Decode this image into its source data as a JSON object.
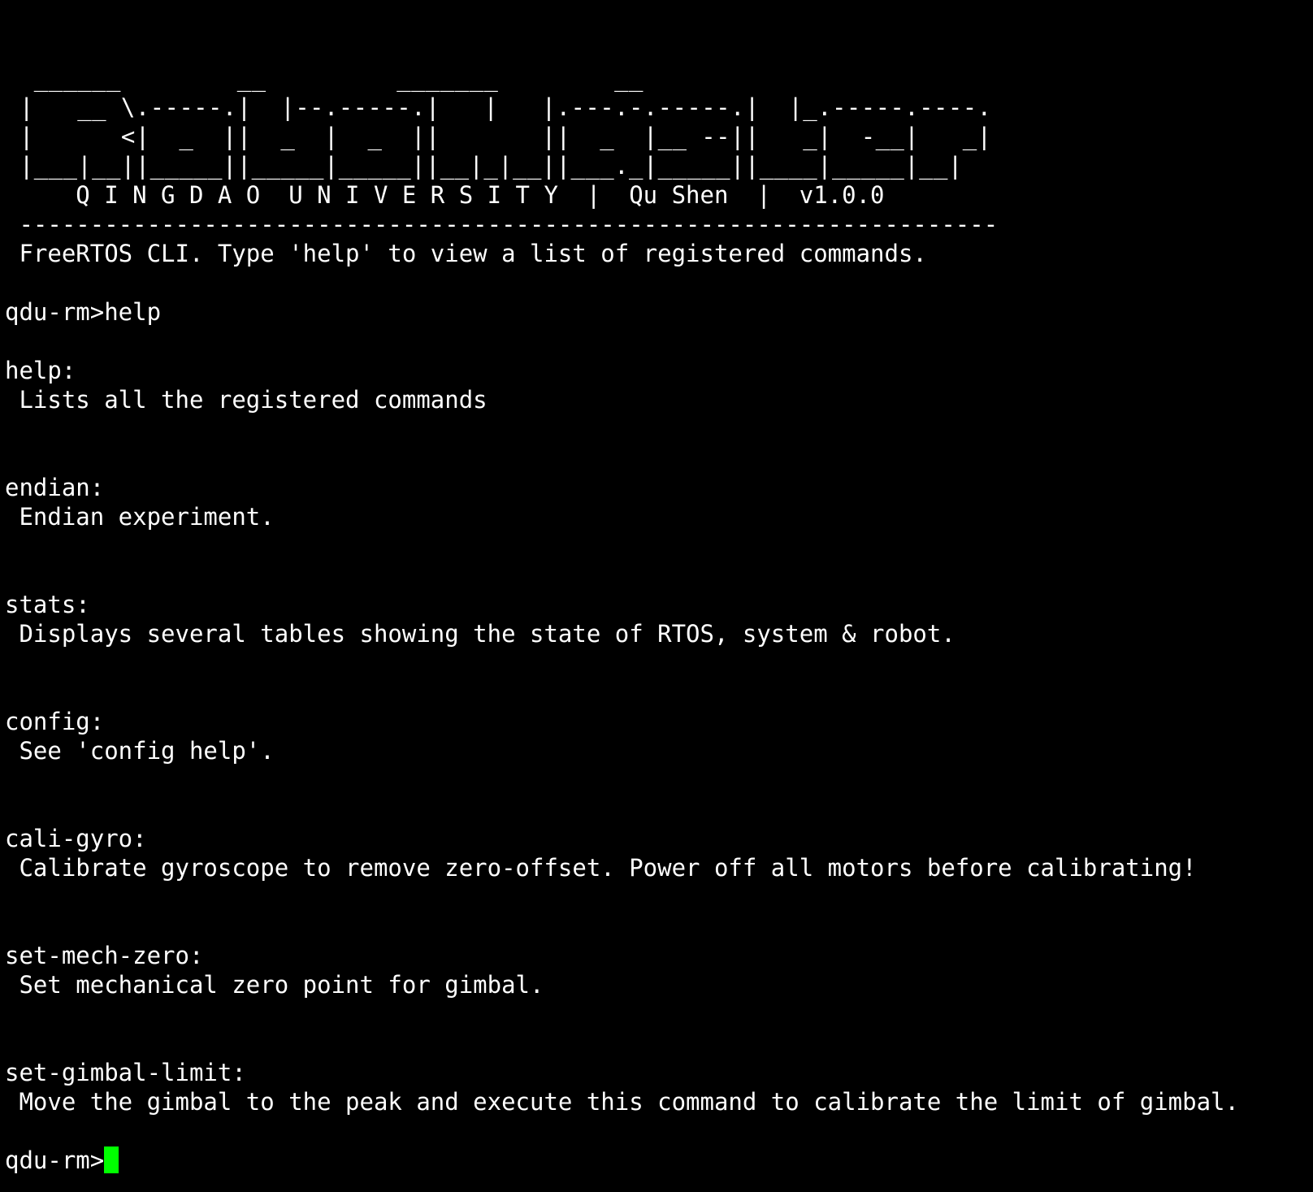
{
  "colors": {
    "background": "#000000",
    "foreground": "#ffffff",
    "cursor": "#00ff00"
  },
  "banner": {
    "art": [
      "  ______        __         _______        __",
      " |   __ \\.-----.|  |--.-----.|   |   |.---.-.-----.|  |_.-----.----.",
      " |      <|  _  ||  _  |  _  ||       ||  _  |__ --||   _|  -__|   _|",
      " |___|__||_____||_____|_____||__|_|__||___._|_____||____|_____|__|",
      "     Q I N G D A O  U N I V E R S I T Y  |  Qu Shen  |  v1.0.0"
    ],
    "separator": " ---------------------------------------------------------------------",
    "intro": " FreeRTOS CLI. Type 'help' to view a list of registered commands."
  },
  "session": {
    "prompt": "qdu-rm>",
    "entered_command": "help"
  },
  "commands": [
    {
      "name": "help:",
      "description": " Lists all the registered commands"
    },
    {
      "name": "endian:",
      "description": " Endian experiment."
    },
    {
      "name": "stats:",
      "description": " Displays several tables showing the state of RTOS, system & robot."
    },
    {
      "name": "config:",
      "description": " See 'config help'."
    },
    {
      "name": "cali-gyro:",
      "description": " Calibrate gyroscope to remove zero-offset. Power off all motors before calibrating!"
    },
    {
      "name": "set-mech-zero:",
      "description": " Set mechanical zero point for gimbal."
    },
    {
      "name": "set-gimbal-limit:",
      "description": " Move the gimbal to the peak and execute this command to calibrate the limit of gimbal."
    }
  ]
}
